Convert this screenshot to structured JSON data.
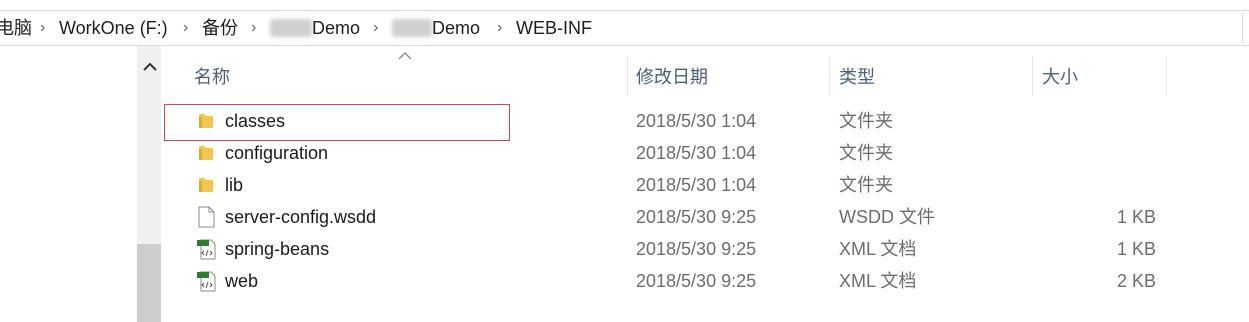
{
  "breadcrumb": {
    "items": [
      "电脑",
      "WorkOne (F:)",
      "备份",
      "Demo",
      "Demo",
      "WEB-INF"
    ],
    "separator_icon": "chevron-right-icon"
  },
  "columns": {
    "name": "名称",
    "date": "修改日期",
    "type": "类型",
    "size": "大小"
  },
  "rows": [
    {
      "name": "classes",
      "date": "2018/5/30 1:04",
      "type": "文件夹",
      "size": "",
      "icon": "folder-icon",
      "selected_highlight": true
    },
    {
      "name": "configuration",
      "date": "2018/5/30 1:04",
      "type": "文件夹",
      "size": "",
      "icon": "folder-icon"
    },
    {
      "name": "lib",
      "date": "2018/5/30 1:04",
      "type": "文件夹",
      "size": "",
      "icon": "folder-icon"
    },
    {
      "name": "server-config.wsdd",
      "date": "2018/5/30 9:25",
      "type": "WSDD 文件",
      "size": "1 KB",
      "icon": "file-icon"
    },
    {
      "name": "spring-beans",
      "date": "2018/5/30 9:25",
      "type": "XML 文档",
      "size": "1 KB",
      "icon": "xml-file-icon"
    },
    {
      "name": "web",
      "date": "2018/5/30 9:25",
      "type": "XML 文档",
      "size": "2 KB",
      "icon": "xml-file-icon"
    }
  ],
  "colors": {
    "folder": "#f3c74f",
    "highlight_border": "#dd4444",
    "header_text": "#4c607a"
  }
}
